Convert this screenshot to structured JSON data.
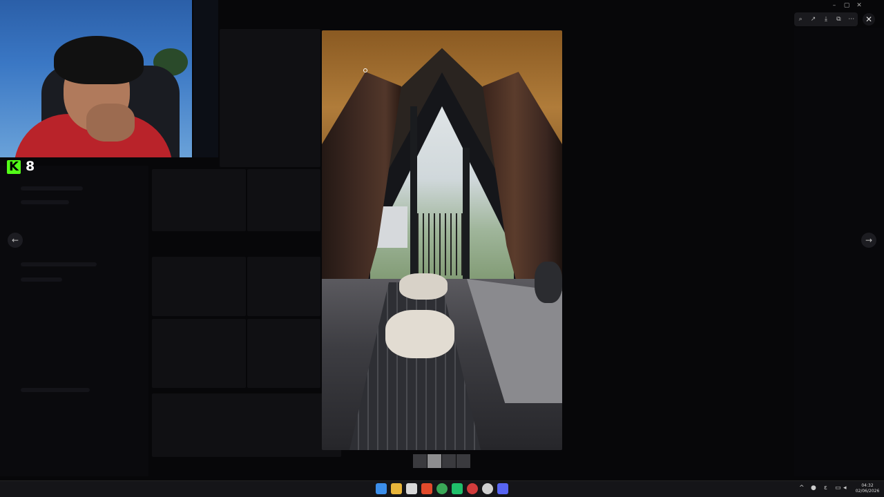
{
  "stream": {
    "kick_viewer_count": "8",
    "kick_logo_letter": "K",
    "kick_color": "#53fc18"
  },
  "viewer": {
    "close_icon": "✕",
    "prev_icon": "←",
    "next_icon": "→",
    "toolbar_icons": [
      "zoom-icon",
      "forward-icon",
      "download-icon",
      "open-external-icon",
      "more-icon"
    ],
    "toolbar_glyphs": [
      "⌕",
      "↗",
      "⤓",
      "⧉",
      "⋯"
    ],
    "thumbnail_count": 4,
    "active_thumbnail": 2
  },
  "window_controls": {
    "minimize": "–",
    "maximize": "▢",
    "close": "✕"
  },
  "taskbar": {
    "apps": [
      {
        "name": "windows-start-icon",
        "color": "#3b8eea"
      },
      {
        "name": "file-explorer-icon",
        "color": "#e8b53a"
      },
      {
        "name": "calendar-icon",
        "color": "#d9d9d9"
      },
      {
        "name": "brave-browser-icon",
        "color": "#e24a2b"
      },
      {
        "name": "chrome-icon",
        "color": "#3aa757"
      },
      {
        "name": "app-icon-green",
        "color": "#1fbf6a"
      },
      {
        "name": "app-icon-red",
        "color": "#d23c3c"
      },
      {
        "name": "settings-icon",
        "color": "#cfcfcf"
      },
      {
        "name": "discord-icon",
        "color": "#5865f2"
      }
    ],
    "clock_time": "04:32",
    "clock_date": "02/06/2026"
  }
}
